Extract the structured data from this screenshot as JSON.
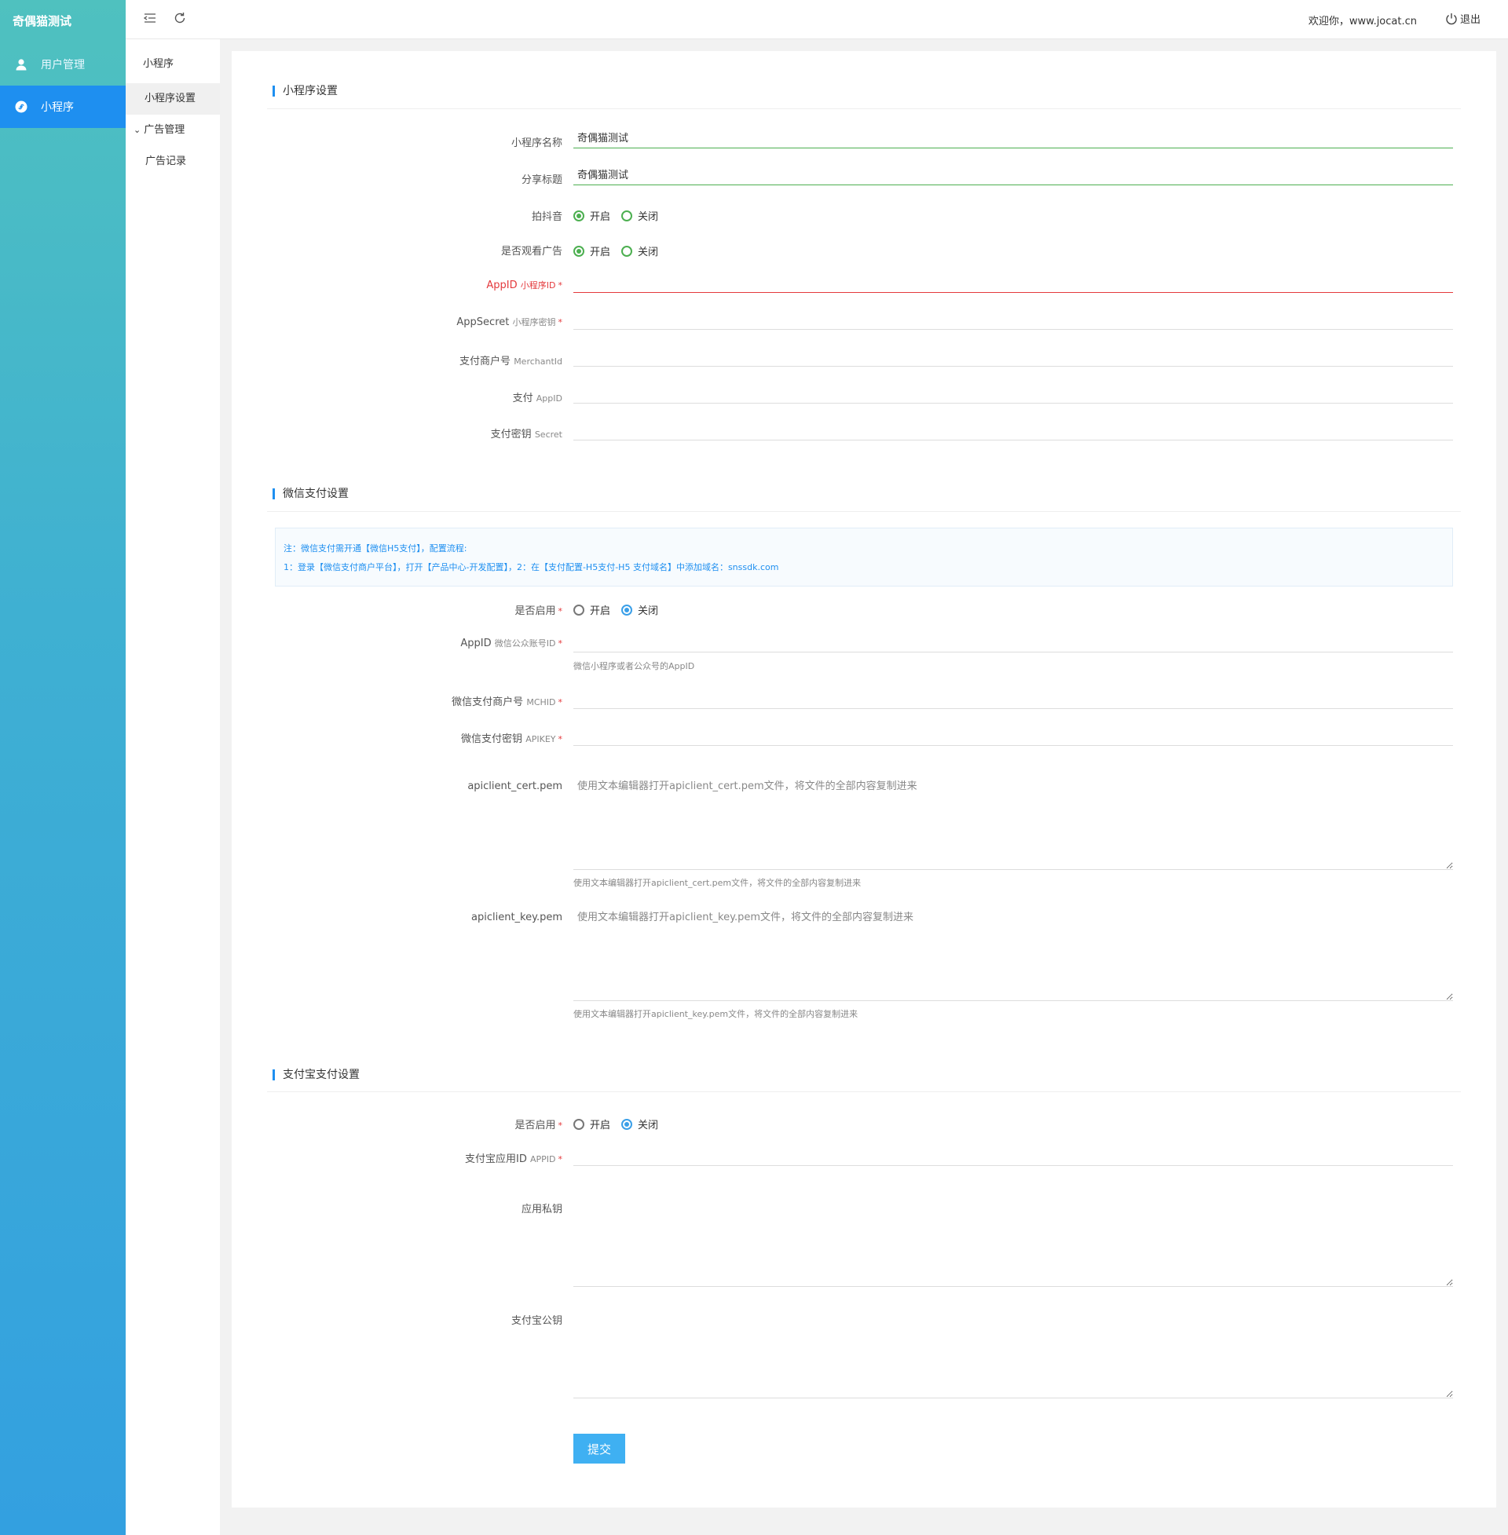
{
  "app": {
    "brand": "奇偶猫测试"
  },
  "sidebar": {
    "items": [
      {
        "label": "用户管理",
        "icon": "user-icon",
        "active": false
      },
      {
        "label": "小程序",
        "icon": "miniprogram-icon",
        "active": true
      }
    ]
  },
  "subnav": {
    "title": "小程序",
    "items": [
      {
        "label": "小程序设置"
      }
    ],
    "group": {
      "label": "广告管理",
      "children": [
        {
          "label": "广告记录"
        }
      ]
    }
  },
  "header": {
    "welcome": "欢迎你，www.jocat.cn",
    "logout": "退出"
  },
  "sections": {
    "miniapp": {
      "title": "小程序设置",
      "name": {
        "label": "小程序名称",
        "value": "奇偶猫测试"
      },
      "share": {
        "label": "分享标题",
        "value": "奇偶猫测试"
      },
      "douyin": {
        "label": "拍抖音",
        "on": "开启",
        "off": "关闭"
      },
      "ads": {
        "label": "是否观看广告",
        "on": "开启",
        "off": "关闭"
      },
      "appid": {
        "label": "AppID",
        "sub": "小程序ID",
        "req": "*"
      },
      "secret": {
        "label": "AppSecret",
        "sub": "小程序密钥",
        "req": "*"
      },
      "merchant": {
        "label": "支付商户号",
        "sub": "MerchantId"
      },
      "payappid": {
        "label": "支付",
        "sub": "AppID"
      },
      "paysecret": {
        "label": "支付密钥",
        "sub": "Secret"
      }
    },
    "wechat": {
      "title": "微信支付设置",
      "notice_line1": "注：微信支付需开通【微信H5支付】，配置流程:",
      "notice_line2": "1：登录【微信支付商户平台】，打开【产品中心-开发配置】，2：在【支付配置-H5支付-H5 支付域名】中添加域名：snssdk.com",
      "enable": {
        "label": "是否启用",
        "req": "*",
        "on": "开启",
        "off": "关闭"
      },
      "appid": {
        "label": "AppID",
        "sub": "微信公众账号ID",
        "req": "*",
        "help": "微信小程序或者公众号的AppID"
      },
      "mchid": {
        "label": "微信支付商户号",
        "sub": "MCHID",
        "req": "*"
      },
      "apikey": {
        "label": "微信支付密钥",
        "sub": "APIKEY",
        "req": "*"
      },
      "cert": {
        "label": "apiclient_cert.pem",
        "placeholder": "使用文本编辑器打开apiclient_cert.pem文件，将文件的全部内容复制进来",
        "help": "使用文本编辑器打开apiclient_cert.pem文件，将文件的全部内容复制进来"
      },
      "key": {
        "label": "apiclient_key.pem",
        "placeholder": "使用文本编辑器打开apiclient_key.pem文件，将文件的全部内容复制进来",
        "help": "使用文本编辑器打开apiclient_key.pem文件，将文件的全部内容复制进来"
      }
    },
    "alipay": {
      "title": "支付宝支付设置",
      "enable": {
        "label": "是否启用",
        "req": "*",
        "on": "开启",
        "off": "关闭"
      },
      "appid": {
        "label": "支付宝应用ID",
        "sub": "APPID",
        "req": "*"
      },
      "privkey": {
        "label": "应用私钥"
      },
      "pubkey": {
        "label": "支付宝公钥"
      }
    }
  },
  "form": {
    "submit": "提交"
  }
}
